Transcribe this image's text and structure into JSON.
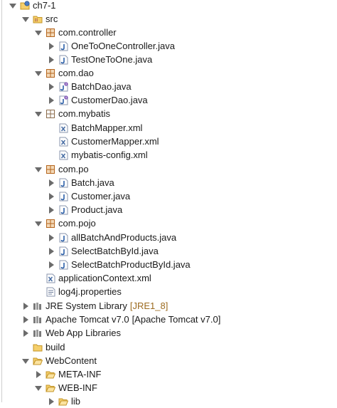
{
  "project": {
    "name": "ch7-1",
    "src": {
      "label": "src",
      "packages": [
        {
          "label": "com.controller",
          "files": [
            "OneToOneController.java",
            "TestOneToOne.java"
          ]
        },
        {
          "label": "com.dao",
          "files": [
            "BatchDao.java",
            "CustomerDao.java"
          ]
        },
        {
          "label": "com.mybatis",
          "files": [
            "BatchMapper.xml",
            "CustomerMapper.xml",
            "mybatis-config.xml"
          ]
        },
        {
          "label": "com.po",
          "files": [
            "Batch.java",
            "Customer.java",
            "Product.java"
          ]
        },
        {
          "label": "com.pojo",
          "files": [
            "allBatchAndProducts.java",
            "SelectBatchById.java",
            "SelectBatchProductById.java"
          ]
        }
      ],
      "root_files": [
        "applicationContext.xml",
        "log4j.properties"
      ]
    },
    "libraries": [
      {
        "label": "JRE System Library",
        "decoration": "[JRE1_8]"
      },
      {
        "label": "Apache Tomcat v7.0",
        "decoration": "[Apache Tomcat v7.0]"
      },
      {
        "label": "Web App Libraries",
        "decoration": ""
      }
    ],
    "folders": {
      "build": "build",
      "webcontent": "WebContent",
      "meta_inf": "META-INF",
      "web_inf": "WEB-INF",
      "lib": "lib"
    }
  },
  "colors": {
    "java_icon": "#2b5fa8",
    "xml_icon": "#5a6e9a",
    "package_icon": "#b5651d",
    "folder_icon": "#e9b84a",
    "triangle": "#6b6b6b"
  }
}
